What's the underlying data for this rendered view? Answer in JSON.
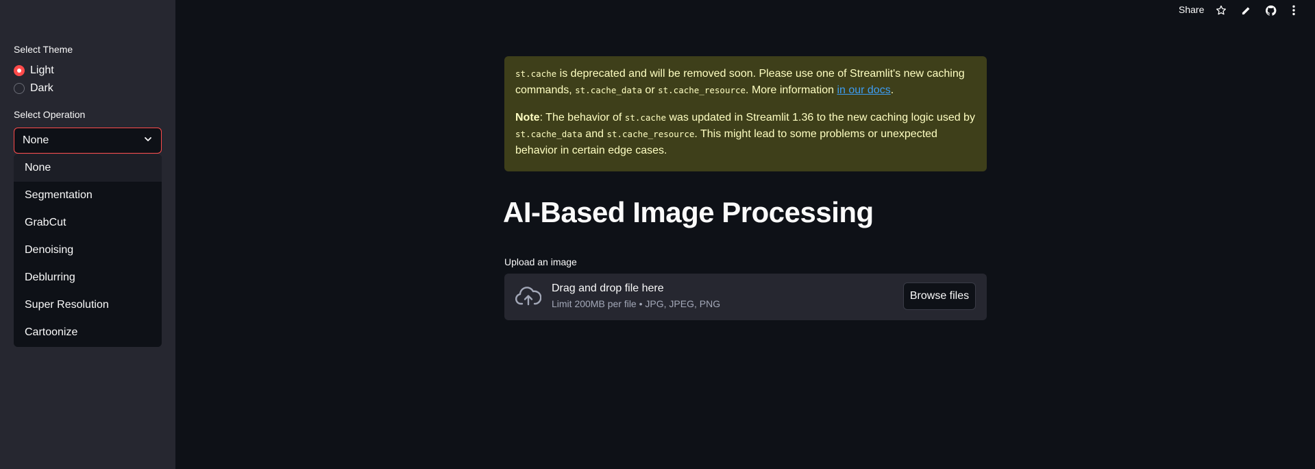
{
  "sidebar": {
    "theme_label": "Select Theme",
    "theme_options": [
      "Light",
      "Dark"
    ],
    "theme_selected": "Light",
    "operation_label": "Select Operation",
    "operation_selected": "None",
    "operation_options": [
      "None",
      "Segmentation",
      "GrabCut",
      "Denoising",
      "Deblurring",
      "Super Resolution",
      "Cartoonize"
    ]
  },
  "toolbar": {
    "share_label": "Share",
    "icons": [
      "star-icon",
      "pencil-icon",
      "github-icon",
      "more-vertical-icon"
    ]
  },
  "alert": {
    "code_cache": "st.cache",
    "p1_text1": " is deprecated and will be removed soon. Please use one of Streamlit's new caching commands, ",
    "code_cache_data": "st.cache_data",
    "p1_or": " or ",
    "code_cache_resource": "st.cache_resource",
    "p1_text2": ". More information ",
    "link_text": "in our docs",
    "p1_end": ".",
    "note_bold": "Note",
    "p2_text1": ": The behavior of ",
    "p2_text2": " was updated in Streamlit 1.36 to the new caching logic used by ",
    "p2_and": " and ",
    "p2_text3": ". This might lead to some problems or unexpected behavior in certain edge cases."
  },
  "main": {
    "title": "AI-Based Image Processing",
    "upload_label": "Upload an image",
    "drop_text": "Drag and drop file here",
    "drop_limit": "Limit 200MB per file • JPG, JPEG, PNG",
    "browse_label": "Browse files"
  },
  "colors": {
    "background": "#0e1117",
    "sidebar": "#262730",
    "accent": "#ff4b4b",
    "alert_bg": "#3e3f1a",
    "alert_text": "#ffffc2",
    "link": "#3d9df3"
  }
}
